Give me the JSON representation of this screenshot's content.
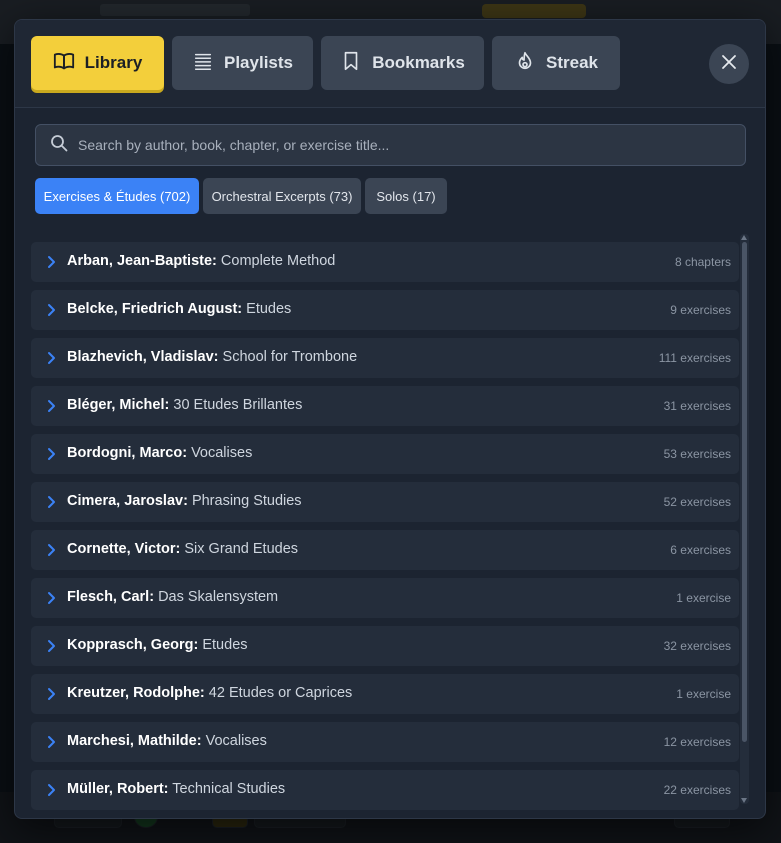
{
  "tabs": [
    {
      "label": "Library",
      "icon": "book-open-icon",
      "active": true
    },
    {
      "label": "Playlists",
      "icon": "list-icon",
      "active": false
    },
    {
      "label": "Bookmarks",
      "icon": "bookmark-icon",
      "active": false
    },
    {
      "label": "Streak",
      "icon": "flame-icon",
      "active": false
    }
  ],
  "close_icon": "close-icon",
  "search": {
    "placeholder": "Search by author, book, chapter, or exercise title...",
    "value": "",
    "icon": "search-icon"
  },
  "filters": [
    {
      "label": "Exercises & Études (702)",
      "active": true
    },
    {
      "label": "Orchestral Excerpts (73)",
      "active": false
    },
    {
      "label": "Solos (17)",
      "active": false
    }
  ],
  "library": [
    {
      "author": "Arban, Jean-Baptiste:",
      "book": "Complete Method",
      "count": "8 chapters"
    },
    {
      "author": "Belcke, Friedrich August:",
      "book": "Etudes",
      "count": "9 exercises"
    },
    {
      "author": "Blazhevich, Vladislav:",
      "book": "School for Trombone",
      "count": "111 exercises"
    },
    {
      "author": "Bléger, Michel:",
      "book": "30 Etudes Brillantes",
      "count": "31 exercises"
    },
    {
      "author": "Bordogni, Marco:",
      "book": "Vocalises",
      "count": "53 exercises"
    },
    {
      "author": "Cimera, Jaroslav:",
      "book": "Phrasing Studies",
      "count": "52 exercises"
    },
    {
      "author": "Cornette, Victor:",
      "book": "Six Grand Etudes",
      "count": "6 exercises"
    },
    {
      "author": "Flesch, Carl:",
      "book": "Das Skalensystem",
      "count": "1 exercise"
    },
    {
      "author": "Kopprasch, Georg:",
      "book": "Etudes",
      "count": "32 exercises"
    },
    {
      "author": "Kreutzer, Rodolphe:",
      "book": "42 Etudes or Caprices",
      "count": "1 exercise"
    },
    {
      "author": "Marchesi, Mathilde:",
      "book": "Vocalises",
      "count": "12 exercises"
    },
    {
      "author": "Müller, Robert:",
      "book": "Technical Studies",
      "count": "22 exercises"
    }
  ],
  "colors": {
    "accent_yellow": "#f3cf3b",
    "accent_blue": "#3b82f6",
    "panel": "#1c2431",
    "row": "#242d3b"
  }
}
